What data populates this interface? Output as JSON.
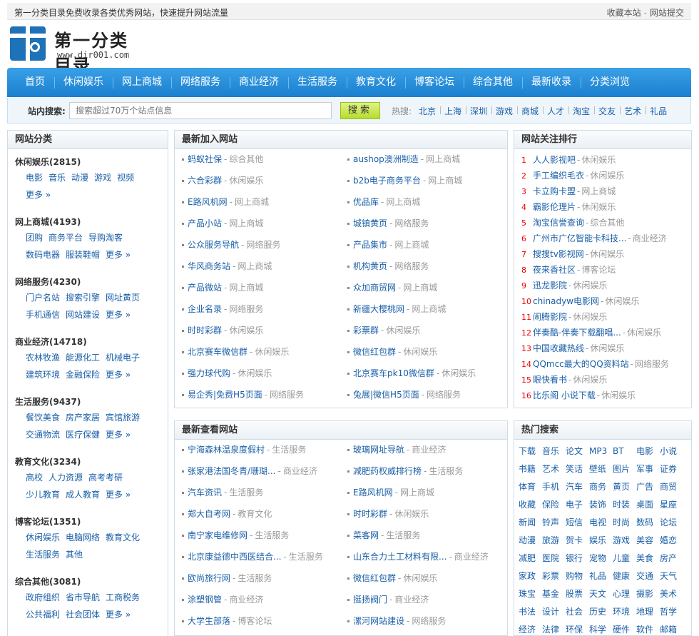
{
  "topbar": {
    "slogan": "第一分类目录免费收录各类优秀网站，快速提升网站流量",
    "bookmark": "收藏本站",
    "submit": "网站提交"
  },
  "logo": {
    "name": "第一分类目录",
    "url": "www.dir001.com"
  },
  "nav": [
    "首页",
    "休闲娱乐",
    "网上商城",
    "网络服务",
    "商业经济",
    "生活服务",
    "教育文化",
    "博客论坛",
    "综合其他",
    "最新收录",
    "分类浏览"
  ],
  "search": {
    "label": "站内搜索:",
    "placeholder": "搜索超过70万个站点信息",
    "button": "搜索",
    "hot_label": "热搜:",
    "hot": [
      "北京",
      "上海",
      "深圳",
      "游戏",
      "商城",
      "人才",
      "淘宝",
      "交友",
      "艺术",
      "礼品"
    ]
  },
  "categories": {
    "title": "网站分类",
    "groups": [
      {
        "name": "休闲娱乐(2815)",
        "items": [
          "电影",
          "音乐",
          "动漫",
          "游戏",
          "视频"
        ],
        "more": "更多 »"
      },
      {
        "name": "网上商城(4193)",
        "items": [
          "团购",
          "商务平台",
          "导购淘客",
          "数码电器",
          "服装鞋帽"
        ],
        "more": "更多 »"
      },
      {
        "name": "网络服务(4230)",
        "items": [
          "门户名站",
          "搜索引擎",
          "网址黄页",
          "手机通信",
          "网站建设"
        ],
        "more": "更多 »"
      },
      {
        "name": "商业经济(14718)",
        "items": [
          "农林牧渔",
          "能源化工",
          "机械电子",
          "建筑环境",
          "金融保险"
        ],
        "more": "更多 »"
      },
      {
        "name": "生活服务(9437)",
        "items": [
          "餐饮美食",
          "房产家居",
          "宾馆旅游",
          "交通物流",
          "医疗保健"
        ],
        "more": "更多 »"
      },
      {
        "name": "教育文化(3234)",
        "items": [
          "高校",
          "人力资源",
          "高考考研",
          "少儿教育",
          "成人教育"
        ],
        "more": "更多 »"
      },
      {
        "name": "博客论坛(1351)",
        "items": [
          "休闲娱乐",
          "电脑网络",
          "教育文化",
          "生活服务",
          "其他"
        ],
        "more": ""
      },
      {
        "name": "综合其他(3081)",
        "items": [
          "政府组织",
          "省市导航",
          "工商税务",
          "公共福利",
          "社会团体"
        ],
        "more": "更多 »"
      }
    ]
  },
  "new_sites": {
    "title": "最新加入网站",
    "items": [
      {
        "name": "蚂蚁社保",
        "cat": "综合其他"
      },
      {
        "name": "aushop澳洲制造",
        "cat": "网上商城"
      },
      {
        "name": "六合彩群",
        "cat": "休闲娱乐"
      },
      {
        "name": "b2b电子商务平台",
        "cat": "网上商城"
      },
      {
        "name": "E路风机网",
        "cat": "网上商城"
      },
      {
        "name": "优品库",
        "cat": "网上商城"
      },
      {
        "name": "产品小站",
        "cat": "网上商城"
      },
      {
        "name": "城镇黄页",
        "cat": "网络服务"
      },
      {
        "name": "公众服务导航",
        "cat": "网络服务"
      },
      {
        "name": "产品集市",
        "cat": "网上商城"
      },
      {
        "name": "华风商务站",
        "cat": "网上商城"
      },
      {
        "name": "机构黄页",
        "cat": "网络服务"
      },
      {
        "name": "产品微站",
        "cat": "网上商城"
      },
      {
        "name": "众加商贸网",
        "cat": "网上商城"
      },
      {
        "name": "企业名录",
        "cat": "网络服务"
      },
      {
        "name": "新疆大樱桃网",
        "cat": "网上商城"
      },
      {
        "name": "时时彩群",
        "cat": "休闲娱乐"
      },
      {
        "name": "彩票群",
        "cat": "休闲娱乐"
      },
      {
        "name": "北京赛车微信群",
        "cat": "休闲娱乐"
      },
      {
        "name": "微信红包群",
        "cat": "休闲娱乐"
      },
      {
        "name": "强力球代购",
        "cat": "休闲娱乐"
      },
      {
        "name": "北京赛车pk10微信群",
        "cat": "休闲娱乐"
      },
      {
        "name": "易企秀|免费H5页面",
        "cat": "网络服务"
      },
      {
        "name": "兔展|微信H5页面",
        "cat": "网络服务"
      }
    ]
  },
  "viewed_sites": {
    "title": "最新查看网站",
    "items": [
      {
        "name": "宁海森林温泉度假村",
        "cat": "生活服务"
      },
      {
        "name": "玻璃网址导航",
        "cat": "商业经济"
      },
      {
        "name": "张家港法国冬青/珊瑚...",
        "cat": "商业经济"
      },
      {
        "name": "减肥药权威排行榜",
        "cat": "生活服务"
      },
      {
        "name": "汽车资讯",
        "cat": "生活服务"
      },
      {
        "name": "E路风机网",
        "cat": "网上商城"
      },
      {
        "name": "郑大自考网",
        "cat": "教育文化"
      },
      {
        "name": "时时彩群",
        "cat": "休闲娱乐"
      },
      {
        "name": "南宁家电维修网",
        "cat": "生活服务"
      },
      {
        "name": "菜客网",
        "cat": "生活服务"
      },
      {
        "name": "北京康益德中西医结合...",
        "cat": "生活服务"
      },
      {
        "name": "山东合力土工材料有限...",
        "cat": "商业经济"
      },
      {
        "name": "欧尚旅行网",
        "cat": "生活服务"
      },
      {
        "name": "微信红包群",
        "cat": "休闲娱乐"
      },
      {
        "name": "涂塑钢管",
        "cat": "商业经济"
      },
      {
        "name": "挺扬阀门",
        "cat": "商业经济"
      },
      {
        "name": "大学生部落",
        "cat": "博客论坛"
      },
      {
        "name": "漯河网站建设",
        "cat": "网络服务"
      }
    ]
  },
  "ranking": {
    "title": "网站关注排行",
    "items": [
      {
        "no": "1",
        "name": "人人影视吧",
        "cat": "休闲娱乐"
      },
      {
        "no": "2",
        "name": "手工编织毛衣",
        "cat": "休闲娱乐"
      },
      {
        "no": "3",
        "name": "卡立购卡盟",
        "cat": "网上商城"
      },
      {
        "no": "4",
        "name": "霸影伦理片",
        "cat": "休闲娱乐"
      },
      {
        "no": "5",
        "name": "淘宝信誉查询",
        "cat": "综合其他"
      },
      {
        "no": "6",
        "name": "广州市广亿智能卡科技...",
        "cat": "商业经济"
      },
      {
        "no": "7",
        "name": "搜搜tv影视网",
        "cat": "休闲娱乐"
      },
      {
        "no": "8",
        "name": "夜来香社区",
        "cat": "博客论坛"
      },
      {
        "no": "9",
        "name": "迅龙影院",
        "cat": "休闲娱乐"
      },
      {
        "no": "10",
        "name": "chinadyw电影网",
        "cat": "休闲娱乐"
      },
      {
        "no": "11",
        "name": "闹腾影院",
        "cat": "休闲娱乐"
      },
      {
        "no": "12",
        "name": "伴奏酷-伴奏下载翻唱...",
        "cat": "休闲娱乐"
      },
      {
        "no": "13",
        "name": "中国收藏热线",
        "cat": "休闲娱乐"
      },
      {
        "no": "14",
        "name": "QQmcc最大的QQ资料站",
        "cat": "网络服务"
      },
      {
        "no": "15",
        "name": "眼快看书",
        "cat": "休闲娱乐"
      },
      {
        "no": "16",
        "name": "比乐阁 小说下载",
        "cat": "休闲娱乐"
      }
    ]
  },
  "hot_search": {
    "title": "热门搜索",
    "items": [
      "下载",
      "音乐",
      "论文",
      "MP3",
      "BT",
      "电影",
      "小说",
      "书籍",
      "艺术",
      "笑话",
      "壁纸",
      "图片",
      "军事",
      "证券",
      "体育",
      "手机",
      "汽车",
      "商务",
      "黄页",
      "广告",
      "商贸",
      "收藏",
      "保险",
      "电子",
      "装饰",
      "时装",
      "桌面",
      "星座",
      "新闻",
      "铃声",
      "短信",
      "电视",
      "时尚",
      "数码",
      "论坛",
      "动漫",
      "旅游",
      "贺卡",
      "娱乐",
      "游戏",
      "美容",
      "婚恋",
      "减肥",
      "医院",
      "银行",
      "宠物",
      "儿童",
      "美食",
      "房产",
      "家政",
      "彩票",
      "购物",
      "礼品",
      "健康",
      "交通",
      "天气",
      "珠宝",
      "基金",
      "股票",
      "天文",
      "心理",
      "摄影",
      "美术",
      "书法",
      "设计",
      "社会",
      "历史",
      "环境",
      "地理",
      "哲学",
      "经济",
      "法律",
      "环保",
      "科学",
      "硬件",
      "软件",
      "邮箱"
    ]
  }
}
